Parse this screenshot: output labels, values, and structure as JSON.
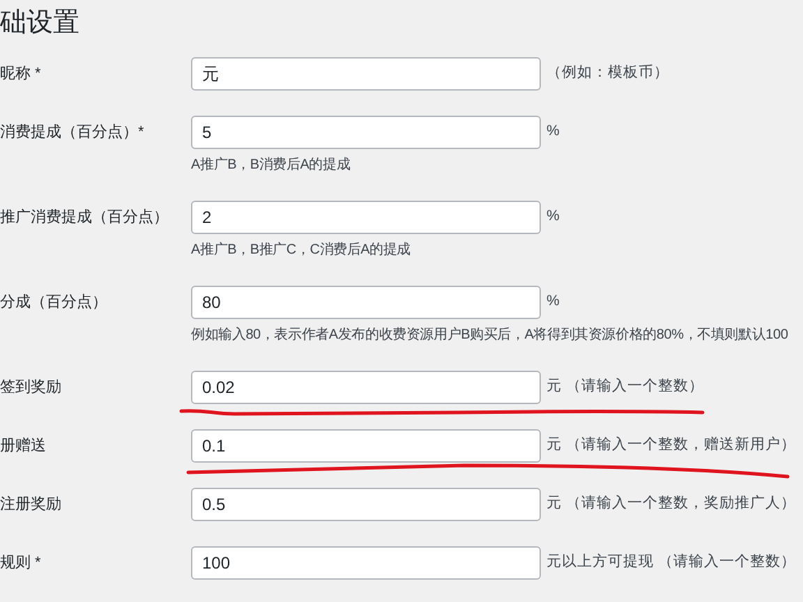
{
  "title": "础设置",
  "fields": [
    {
      "label": "昵称 *",
      "value": "元",
      "suffix": "（例如：模板币）"
    },
    {
      "label": "消费提成（百分点）*",
      "value": "5",
      "suffix": "%",
      "hint": "A推广B，B消费后A的提成"
    },
    {
      "label": "推广消费提成（百分点）",
      "value": "2",
      "suffix": "%",
      "hint": "A推广B，B推广C，C消费后A的提成"
    },
    {
      "label": "分成（百分点）",
      "value": "80",
      "suffix": "%",
      "hint": "例如输入80，表示作者A发布的收费资源用户B购买后，A将得到其资源价格的80%，不填则默认100"
    },
    {
      "label": "签到奖励",
      "value": "0.02",
      "suffix": "元 （请输入一个整数）"
    },
    {
      "label": "册赠送",
      "value": "0.1",
      "suffix": "元 （请输入一个整数，赠送新用户）"
    },
    {
      "label": "注册奖励",
      "value": "0.5",
      "suffix": "元 （请输入一个整数，奖励推广人）"
    },
    {
      "label": "规则 *",
      "value": "100",
      "suffix": "元以上方可提现 （请输入一个整数）"
    }
  ]
}
